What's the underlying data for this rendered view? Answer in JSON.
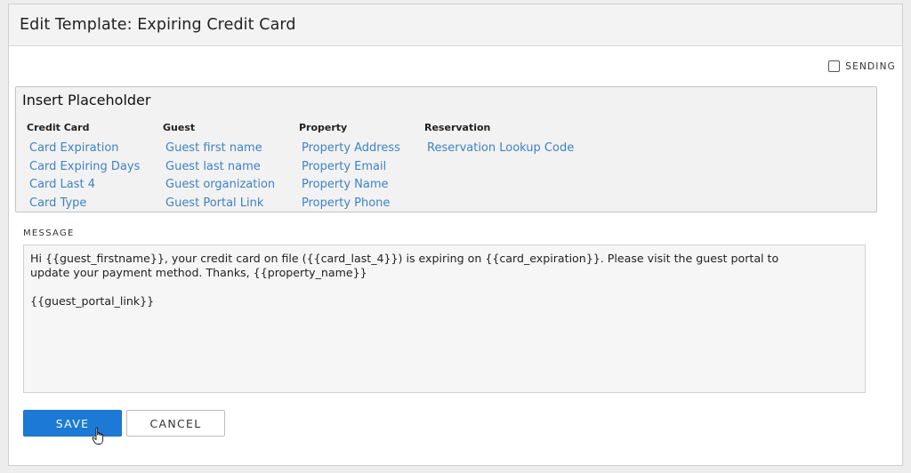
{
  "header": {
    "title": "Edit Template: Expiring Credit Card"
  },
  "sending": {
    "label": "SENDING",
    "checked": false
  },
  "placeholder": {
    "title": "Insert Placeholder",
    "columns": [
      {
        "heading": "Credit Card",
        "items": [
          "Card Expiration",
          "Card Expiring Days",
          "Card Last 4",
          "Card Type"
        ]
      },
      {
        "heading": "Guest",
        "items": [
          "Guest first name",
          "Guest last name",
          "Guest organization",
          "Guest Portal Link"
        ]
      },
      {
        "heading": "Property",
        "items": [
          "Property Address",
          "Property Email",
          "Property Name",
          "Property Phone"
        ]
      },
      {
        "heading": "Reservation",
        "items": [
          "Reservation Lookup Code"
        ]
      }
    ]
  },
  "message": {
    "label": "MESSAGE",
    "value": "Hi {{guest_firstname}}, your credit card on file ({{card_last_4}}) is expiring on {{card_expiration}}. Please visit the guest portal to\nupdate your payment method. Thanks, {{property_name}}\n\n{{guest_portal_link}}"
  },
  "buttons": {
    "save": "SAVE",
    "cancel": "CANCEL"
  },
  "colors": {
    "link": "#3f82c4",
    "primary": "#1c7ad6"
  }
}
